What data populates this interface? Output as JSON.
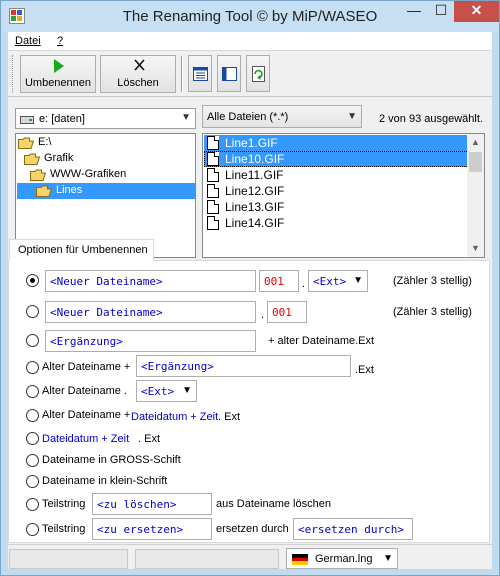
{
  "window": {
    "title": "The Renaming Tool © by MiP/WASEO",
    "minimize": "—",
    "maximize": "☐",
    "close": "✕"
  },
  "menu": {
    "items": [
      {
        "label": "Datei"
      },
      {
        "label": "?"
      }
    ]
  },
  "toolbar": {
    "rename_label": "Umbenennen",
    "delete_label": "Löschen"
  },
  "drive": {
    "value": "e: [daten]"
  },
  "filter": {
    "value": "Alle Dateien (*.*)",
    "selection_status": "2 von 93 ausgewählt."
  },
  "folders": [
    {
      "label": "E:\\",
      "level": 0,
      "selected": false
    },
    {
      "label": "Grafik",
      "level": 1,
      "selected": false
    },
    {
      "label": "WWW-Grafiken",
      "level": 2,
      "selected": false
    },
    {
      "label": "Lines",
      "level": 3,
      "selected": true
    }
  ],
  "files": [
    {
      "name": "Line1.GIF",
      "selected": true
    },
    {
      "name": "Line10.GIF",
      "selected": true
    },
    {
      "name": "Line11.GIF",
      "selected": false
    },
    {
      "name": "Line12.GIF",
      "selected": false
    },
    {
      "name": "Line13.GIF",
      "selected": false
    },
    {
      "name": "Line14.GIF",
      "selected": false
    }
  ],
  "options_tab": {
    "label": "Optionen für Umbenennen"
  },
  "options": {
    "opt1": {
      "name_field": "<Neuer Dateiname>",
      "counter": "001",
      "dot": ".",
      "ext_select": "<Ext>",
      "note": "(Zähler 3 stellig)"
    },
    "opt2": {
      "name_field": "<Neuer Dateiname>",
      "dot": ".",
      "counter": "001",
      "note": "(Zähler 3 stellig)"
    },
    "opt3": {
      "supplement_field": "<Ergänzung>",
      "suffix": "+ alter Dateiname.Ext"
    },
    "opt4": {
      "prefix": "Alter Dateiname +",
      "supplement_field": "<Ergänzung>",
      "suffix": ".Ext"
    },
    "opt5": {
      "prefix": "Alter Dateiname .",
      "ext_select": "<Ext>"
    },
    "opt6": {
      "prefix": "Alter Dateiname +",
      "date_text": "Dateidatum + Zeit",
      "suffix": ". Ext"
    },
    "opt7": {
      "date_text": "Dateidatum + Zeit",
      "suffix": ". Ext"
    },
    "opt8": {
      "label": "Dateiname in GROSS-Schift"
    },
    "opt9": {
      "label": "Dateiname in klein-Schrift"
    },
    "opt10": {
      "prefix": "Teilstring",
      "delete_field": "<zu löschen>",
      "suffix": "aus Dateiname löschen"
    },
    "opt11": {
      "prefix": "Teilstring",
      "replace_field": "<zu ersetzen>",
      "middle": "ersetzen durch",
      "replacement_field": "<ersetzen durch>"
    }
  },
  "status": {
    "language": "German.lng"
  }
}
